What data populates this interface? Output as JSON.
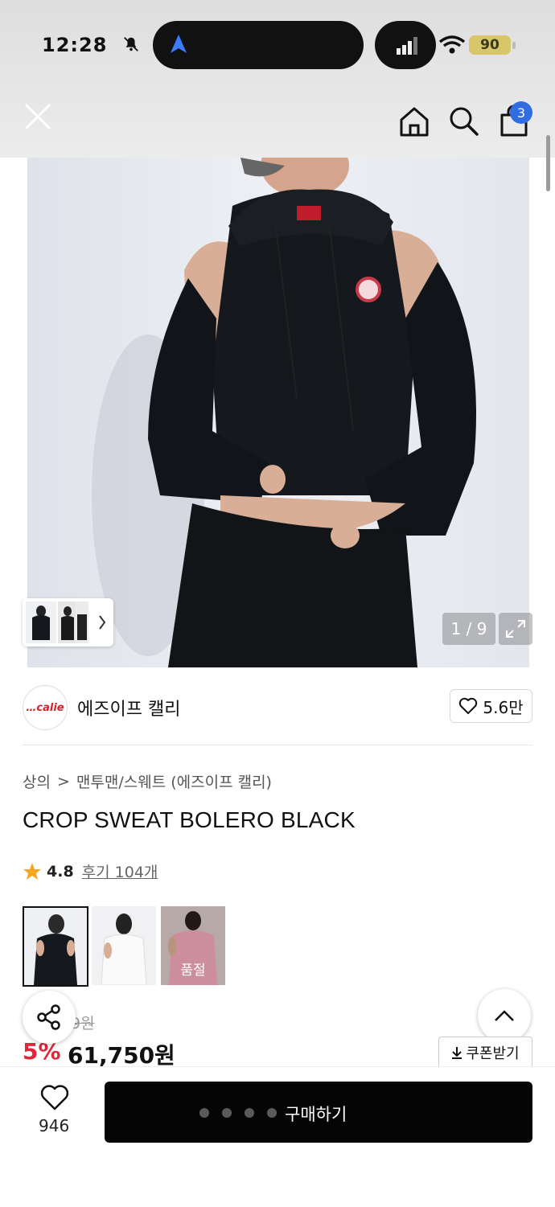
{
  "status_bar": {
    "time": "12:28",
    "battery": "90"
  },
  "header": {
    "cart_count": "3"
  },
  "gallery": {
    "counter": "1 / 9"
  },
  "brand": {
    "logo_text": "…calie",
    "name": "에즈이프 캘리",
    "likes": "5.6만"
  },
  "breadcrumb": {
    "category": "상의",
    "separator": ">",
    "subcategory": "맨투맨/스웨트 (에즈이프 캘리)"
  },
  "product": {
    "title": "CROP SWEAT BOLERO BLACK",
    "rating": "4.8",
    "reviews": "후기 104개",
    "soldout_label": "품절",
    "original_price": "9원",
    "discount": "5%",
    "price": "61,750원"
  },
  "actions": {
    "coupon": "쿠폰받기",
    "heart_count": "946",
    "buy": "구매하기"
  },
  "colors": {
    "accent_blue": "#2f6de1",
    "discount_red": "#e0263a",
    "star": "#f5a623"
  },
  "icons": [
    "close-icon",
    "home-icon",
    "search-icon",
    "cart-icon",
    "heart-icon",
    "star-icon",
    "share-icon",
    "chevron-up-icon",
    "download-icon",
    "expand-icon",
    "chevron-right-icon"
  ]
}
